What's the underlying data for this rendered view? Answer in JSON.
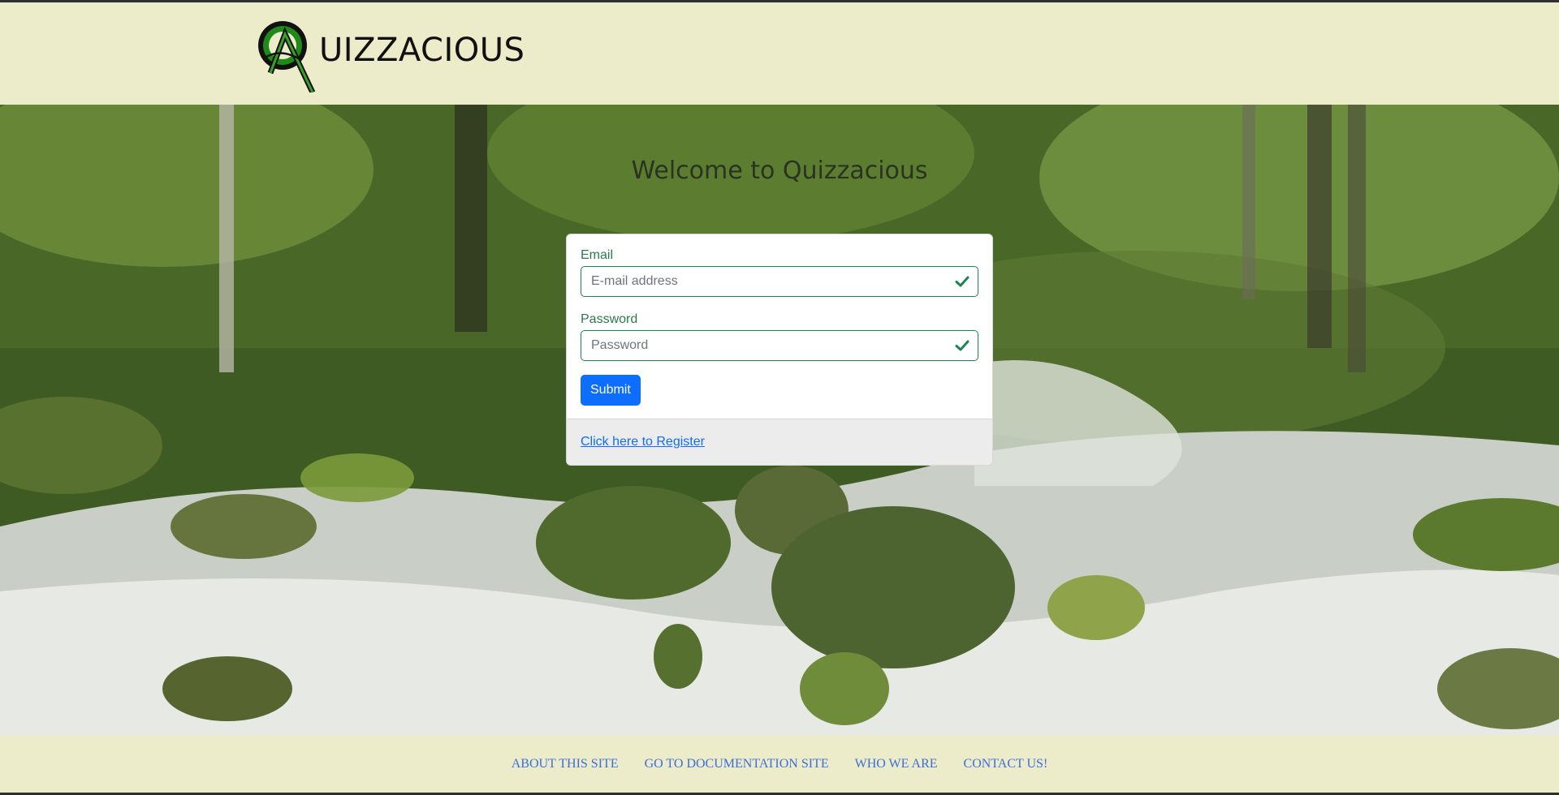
{
  "header": {
    "brand_text": "UIZZACIOUS",
    "logo_icon": "quizzacious-q-logo"
  },
  "main": {
    "welcome_title": "Welcome to Quizzacious",
    "form": {
      "email_label": "Email",
      "email_placeholder": "E-mail address",
      "password_label": "Password",
      "password_placeholder": "Password",
      "submit_label": "Submit",
      "valid_icon": "checkmark-icon"
    },
    "register_link": "Click here to Register"
  },
  "footer": {
    "links": [
      "ABOUT THIS SITE",
      "GO TO DOCUMENTATION SITE",
      "WHO WE ARE",
      "CONTACT US!"
    ]
  },
  "colors": {
    "header_bg": "#ececcb",
    "accent_green": "#198754",
    "primary_blue": "#0d6efd",
    "link_blue": "#3a6fd8"
  }
}
